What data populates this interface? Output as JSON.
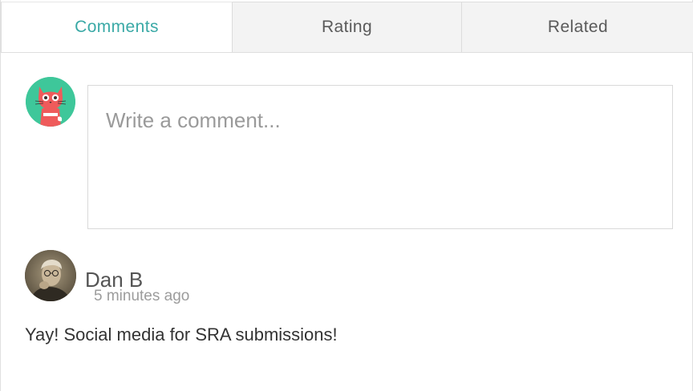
{
  "tabs": [
    {
      "label": "Comments",
      "active": true
    },
    {
      "label": "Rating",
      "active": false
    },
    {
      "label": "Related",
      "active": false
    }
  ],
  "composer": {
    "placeholder": "Write a comment...",
    "value": "",
    "avatar_icon": "cat-avatar-icon"
  },
  "comments": [
    {
      "author": "Dan B",
      "time": "5 minutes ago",
      "text": "Yay! Social media for SRA submissions!"
    }
  ],
  "colors": {
    "accent": "#3aa9a6",
    "avatar_bg": "#3ec79a",
    "cat": "#ef5b5b"
  }
}
